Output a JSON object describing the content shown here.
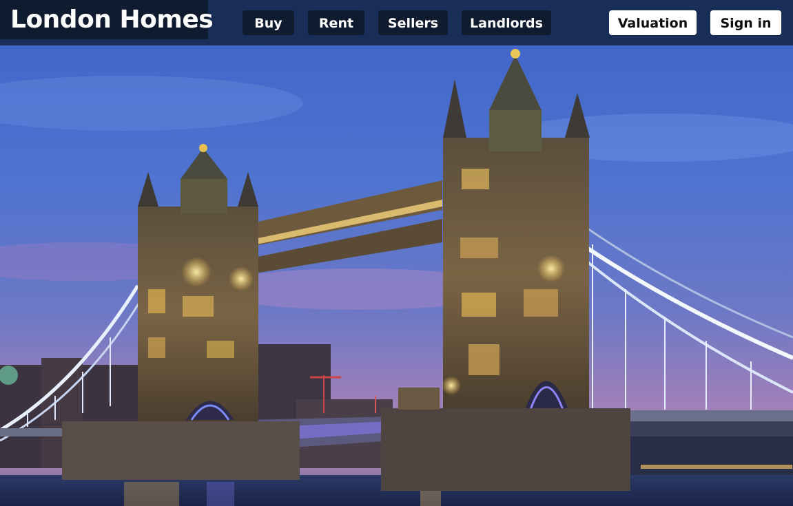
{
  "brand": {
    "name": "London Homes"
  },
  "nav": {
    "items": [
      {
        "label": "Buy"
      },
      {
        "label": "Rent"
      },
      {
        "label": "Sellers"
      },
      {
        "label": "Landlords"
      }
    ]
  },
  "actions": {
    "valuation_label": "Valuation",
    "signin_label": "Sign in"
  },
  "hero": {
    "scene": "tower-bridge-dusk"
  },
  "colors": {
    "topbar": "#162a4e",
    "brand_bg": "#0f1b2e",
    "nav_button": "#0f1b2e",
    "action_button": "#ffffff"
  }
}
